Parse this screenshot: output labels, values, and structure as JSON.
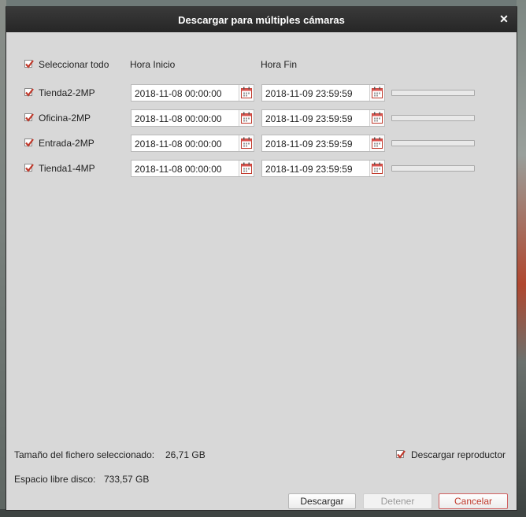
{
  "dialog": {
    "title": "Descargar para múltiples cámaras"
  },
  "header": {
    "select_all_label": "Seleccionar todo",
    "select_all_checked": true,
    "start_col": "Hora Inicio",
    "end_col": "Hora Fin"
  },
  "cameras": [
    {
      "name": "Tienda2-2MP",
      "checked": true,
      "start": "2018-11-08 00:00:00",
      "end": "2018-11-09 23:59:59",
      "progress": 0
    },
    {
      "name": "Oficina-2MP",
      "checked": true,
      "start": "2018-11-08 00:00:00",
      "end": "2018-11-09 23:59:59",
      "progress": 0
    },
    {
      "name": "Entrada-2MP",
      "checked": true,
      "start": "2018-11-08 00:00:00",
      "end": "2018-11-09 23:59:59",
      "progress": 0
    },
    {
      "name": "Tienda1-4MP",
      "checked": true,
      "start": "2018-11-08 00:00:00",
      "end": "2018-11-09 23:59:59",
      "progress": 0
    }
  ],
  "footer": {
    "file_size_label": "Tamaño del fichero seleccionado:",
    "file_size_value": "26,71 GB",
    "free_space_label": "Espacio libre disco:",
    "free_space_value": "733,57 GB",
    "download_player_label": "Descargar reproductor",
    "download_player_checked": true
  },
  "buttons": {
    "download": "Descargar",
    "stop": "Detener",
    "cancel": "Cancelar"
  },
  "colors": {
    "check_mark": "#c0392b",
    "title_bar": "#2e2e2e",
    "dialog_bg": "#d8d8d8"
  }
}
